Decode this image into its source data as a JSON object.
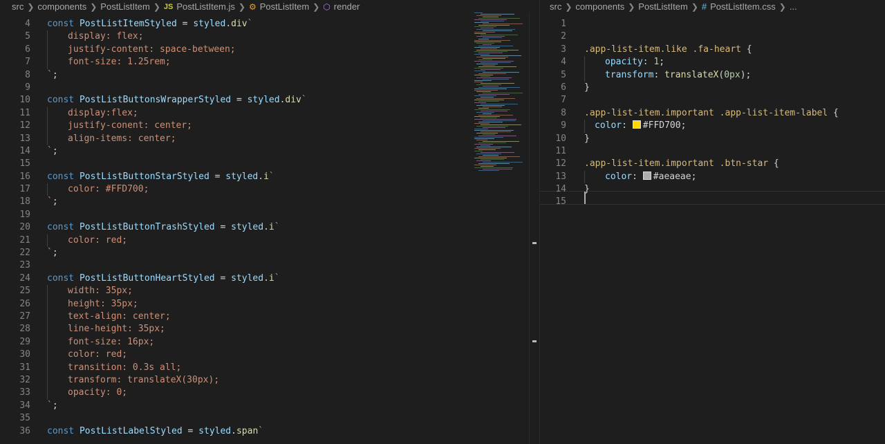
{
  "left": {
    "breadcrumb": [
      "src",
      "components",
      "PostListItem",
      "PostListItem.js",
      "PostListItem",
      "render"
    ],
    "lines": [
      {
        "n": "4",
        "indent": 0,
        "tokens": [
          [
            "kw",
            "const "
          ],
          [
            "id",
            "PostListItemStyled"
          ],
          [
            "op",
            " = "
          ],
          [
            "id",
            "styled"
          ],
          [
            "op",
            "."
          ],
          [
            "fn",
            "div"
          ],
          [
            "str",
            "`"
          ]
        ]
      },
      {
        "n": "5",
        "indent": 1,
        "tokens": [
          [
            "str",
            "display: flex;"
          ]
        ]
      },
      {
        "n": "6",
        "indent": 1,
        "tokens": [
          [
            "str",
            "justify-content: space-between;"
          ]
        ]
      },
      {
        "n": "7",
        "indent": 1,
        "tokens": [
          [
            "str",
            "font-size: 1.25rem;"
          ]
        ]
      },
      {
        "n": "8",
        "indent": 0,
        "tokens": [
          [
            "str",
            "`"
          ],
          [
            "op",
            ";"
          ]
        ]
      },
      {
        "n": "9",
        "indent": 0,
        "tokens": []
      },
      {
        "n": "10",
        "indent": 0,
        "tokens": [
          [
            "kw",
            "const "
          ],
          [
            "id",
            "PostListButtonsWrapperStyled"
          ],
          [
            "op",
            " = "
          ],
          [
            "id",
            "styled"
          ],
          [
            "op",
            "."
          ],
          [
            "fn",
            "div"
          ],
          [
            "str",
            "`"
          ]
        ]
      },
      {
        "n": "11",
        "indent": 1,
        "tokens": [
          [
            "str",
            "display:flex;"
          ]
        ]
      },
      {
        "n": "12",
        "indent": 1,
        "tokens": [
          [
            "str",
            "justify-conent: center;"
          ]
        ]
      },
      {
        "n": "13",
        "indent": 1,
        "tokens": [
          [
            "str",
            "align-items: center;"
          ]
        ]
      },
      {
        "n": "14",
        "indent": 0,
        "tokens": [
          [
            "str",
            "`"
          ],
          [
            "op",
            ";"
          ]
        ]
      },
      {
        "n": "15",
        "indent": 0,
        "tokens": []
      },
      {
        "n": "16",
        "indent": 0,
        "tokens": [
          [
            "kw",
            "const "
          ],
          [
            "id",
            "PostListButtonStarStyled"
          ],
          [
            "op",
            " = "
          ],
          [
            "id",
            "styled"
          ],
          [
            "op",
            "."
          ],
          [
            "fn",
            "i"
          ],
          [
            "str",
            "`"
          ]
        ]
      },
      {
        "n": "17",
        "indent": 1,
        "tokens": [
          [
            "str",
            "color: #FFD700;"
          ]
        ]
      },
      {
        "n": "18",
        "indent": 0,
        "tokens": [
          [
            "str",
            "`"
          ],
          [
            "op",
            ";"
          ]
        ]
      },
      {
        "n": "19",
        "indent": 0,
        "tokens": []
      },
      {
        "n": "20",
        "indent": 0,
        "tokens": [
          [
            "kw",
            "const "
          ],
          [
            "id",
            "PostListButtonTrashStyled"
          ],
          [
            "op",
            " = "
          ],
          [
            "id",
            "styled"
          ],
          [
            "op",
            "."
          ],
          [
            "fn",
            "i"
          ],
          [
            "str",
            "`"
          ]
        ]
      },
      {
        "n": "21",
        "indent": 1,
        "tokens": [
          [
            "str",
            "color: red;"
          ]
        ]
      },
      {
        "n": "22",
        "indent": 0,
        "tokens": [
          [
            "str",
            "`"
          ],
          [
            "op",
            ";"
          ]
        ]
      },
      {
        "n": "23",
        "indent": 0,
        "tokens": []
      },
      {
        "n": "24",
        "indent": 0,
        "tokens": [
          [
            "kw",
            "const "
          ],
          [
            "id",
            "PostListButtonHeartStyled"
          ],
          [
            "op",
            " = "
          ],
          [
            "id",
            "styled"
          ],
          [
            "op",
            "."
          ],
          [
            "fn",
            "i"
          ],
          [
            "str",
            "`"
          ]
        ]
      },
      {
        "n": "25",
        "indent": 1,
        "tokens": [
          [
            "str",
            "width: 35px;"
          ]
        ]
      },
      {
        "n": "26",
        "indent": 1,
        "tokens": [
          [
            "str",
            "height: 35px;"
          ]
        ]
      },
      {
        "n": "27",
        "indent": 1,
        "tokens": [
          [
            "str",
            "text-align: center;"
          ]
        ]
      },
      {
        "n": "28",
        "indent": 1,
        "tokens": [
          [
            "str",
            "line-height: 35px;"
          ]
        ]
      },
      {
        "n": "29",
        "indent": 1,
        "tokens": [
          [
            "str",
            "font-size: 16px;"
          ]
        ]
      },
      {
        "n": "30",
        "indent": 1,
        "tokens": [
          [
            "str",
            "color: red;"
          ]
        ]
      },
      {
        "n": "31",
        "indent": 1,
        "tokens": [
          [
            "str",
            "transition: 0.3s all;"
          ]
        ]
      },
      {
        "n": "32",
        "indent": 1,
        "tokens": [
          [
            "str",
            "transform: translateX(30px);"
          ]
        ]
      },
      {
        "n": "33",
        "indent": 1,
        "tokens": [
          [
            "str",
            "opacity: 0;"
          ]
        ]
      },
      {
        "n": "34",
        "indent": 0,
        "tokens": [
          [
            "str",
            "`"
          ],
          [
            "op",
            ";"
          ]
        ]
      },
      {
        "n": "35",
        "indent": 0,
        "tokens": []
      },
      {
        "n": "36",
        "indent": 0,
        "tokens": [
          [
            "kw",
            "const "
          ],
          [
            "id",
            "PostListLabelStyled"
          ],
          [
            "op",
            " = "
          ],
          [
            "id",
            "styled"
          ],
          [
            "op",
            "."
          ],
          [
            "fn",
            "span"
          ],
          [
            "str",
            "`"
          ]
        ]
      }
    ]
  },
  "right": {
    "breadcrumb": [
      "src",
      "components",
      "PostListItem",
      "PostListItem.css",
      "..."
    ],
    "lines": [
      {
        "n": "1",
        "indent": 0,
        "tokens": []
      },
      {
        "n": "2",
        "indent": 0,
        "tokens": []
      },
      {
        "n": "3",
        "indent": 0,
        "tokens": [
          [
            "sel",
            ".app-list-item.like .fa-heart"
          ],
          [
            "punc",
            " {"
          ]
        ]
      },
      {
        "n": "4",
        "indent": 1,
        "tokens": [
          [
            "prop",
            "opacity"
          ],
          [
            "punc",
            ": "
          ],
          [
            "num",
            "1"
          ],
          [
            "punc",
            ";"
          ]
        ]
      },
      {
        "n": "5",
        "indent": 1,
        "tokens": [
          [
            "prop",
            "transform"
          ],
          [
            "punc",
            ": "
          ],
          [
            "fn",
            "translateX"
          ],
          [
            "punc",
            "("
          ],
          [
            "num",
            "0px"
          ],
          [
            "punc",
            ");"
          ]
        ]
      },
      {
        "n": "6",
        "indent": 0,
        "tokens": [
          [
            "punc",
            "}"
          ]
        ]
      },
      {
        "n": "7",
        "indent": 0,
        "tokens": []
      },
      {
        "n": "8",
        "indent": 0,
        "tokens": [
          [
            "sel",
            ".app-list-item.important .app-list-item-label"
          ],
          [
            "punc",
            " {"
          ]
        ]
      },
      {
        "n": "9",
        "indent": 0.5,
        "tokens": [
          [
            "prop",
            "color"
          ],
          [
            "punc",
            ": "
          ],
          [
            "swatch",
            "#FFD700"
          ],
          [
            "plain",
            "#FFD700"
          ],
          [
            "punc",
            ";"
          ]
        ]
      },
      {
        "n": "10",
        "indent": 0,
        "tokens": [
          [
            "punc",
            "}"
          ]
        ]
      },
      {
        "n": "11",
        "indent": 0,
        "tokens": []
      },
      {
        "n": "12",
        "indent": 0,
        "tokens": [
          [
            "sel",
            ".app-list-item.important .btn-star"
          ],
          [
            "punc",
            " {"
          ]
        ]
      },
      {
        "n": "13",
        "indent": 1,
        "tokens": [
          [
            "prop",
            "color"
          ],
          [
            "punc",
            ": "
          ],
          [
            "swatch",
            "#aeaeae"
          ],
          [
            "plain",
            "#aeaeae"
          ],
          [
            "punc",
            ";"
          ]
        ]
      },
      {
        "n": "14",
        "indent": 0,
        "tokens": [
          [
            "punc",
            "}"
          ]
        ]
      },
      {
        "n": "15",
        "indent": 0,
        "tokens": []
      }
    ],
    "current_line": "15"
  },
  "colors": {
    "keyword": "#569cd6",
    "identifier": "#9cdcfe",
    "function": "#dcdcaa",
    "string": "#ce9178",
    "number": "#b5cea8",
    "selector": "#d7ba7d",
    "background": "#1e1e1e",
    "line_number": "#858585"
  }
}
